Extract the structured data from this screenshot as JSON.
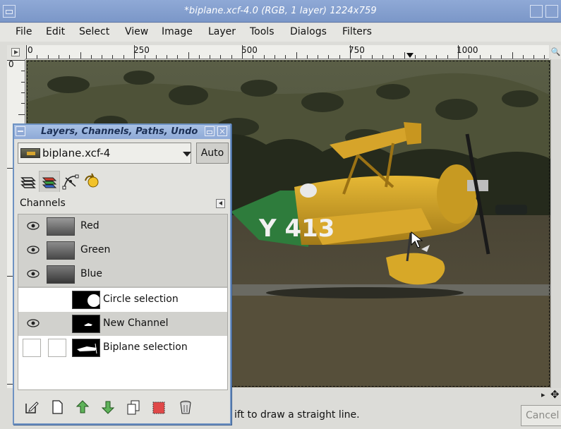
{
  "window": {
    "title": "*biplane.xcf-4.0 (RGB, 1 layer) 1224x759"
  },
  "menu": [
    "File",
    "Edit",
    "Select",
    "View",
    "Image",
    "Layer",
    "Tools",
    "Dialogs",
    "Filters"
  ],
  "ruler": {
    "h_labels": [
      "0",
      "250",
      "500",
      "750",
      "1000"
    ],
    "v_label": "0"
  },
  "status": {
    "hint": "ift to draw a straight line.",
    "cancel": "Cancel"
  },
  "dock": {
    "title": "Layers, Channels, Paths, Undo",
    "image_name": "biplane.xcf-4",
    "auto_label": "Auto",
    "tabs": [
      "layers-icon",
      "channels-icon",
      "paths-icon",
      "undo-icon"
    ],
    "panel_label": "Channels",
    "component_channels": [
      {
        "name": "Red",
        "visible": true
      },
      {
        "name": "Green",
        "visible": true
      },
      {
        "name": "Blue",
        "visible": true
      }
    ],
    "custom_channels": [
      {
        "name": "Circle selection",
        "visible": false
      },
      {
        "name": "New Channel",
        "visible": true
      },
      {
        "name": "Biplane selection",
        "visible": false
      }
    ],
    "buttons": [
      "edit-channel-icon",
      "new-channel-icon",
      "raise-channel-icon",
      "lower-channel-icon",
      "duplicate-channel-icon",
      "channel-to-selection-icon",
      "delete-channel-icon"
    ]
  },
  "canvas": {
    "plane_number": "Y 413"
  },
  "colors": {
    "title_bar": "#8fa9d6",
    "dock_border": "#6e92c2",
    "plane_yellow": "#e7b62e",
    "plane_green": "#2e7c3c"
  }
}
